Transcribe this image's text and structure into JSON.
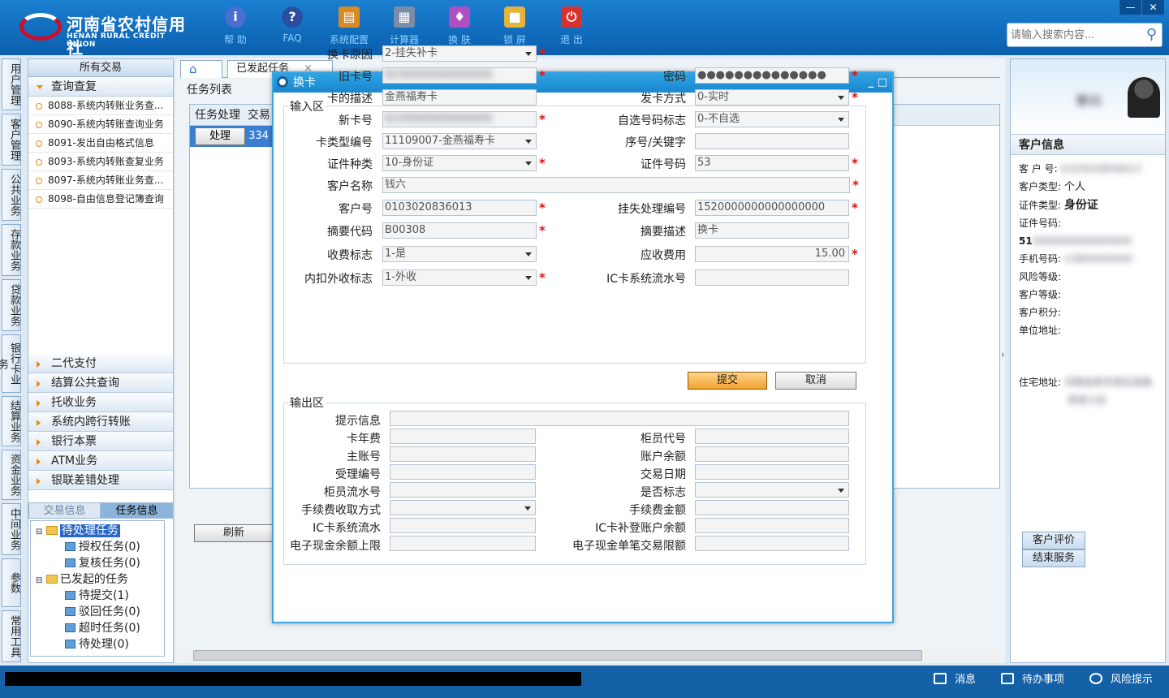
{
  "app": {
    "logo_cn": "河南省农村信用社",
    "logo_en": "HENAN RURAL CREDIT UNION",
    "toolbar": [
      "帮 助",
      "FAQ",
      "系统配置",
      "计算器",
      "换 肤",
      "锁 屏",
      "退 出"
    ],
    "search_placeholder": "请输入搜索内容...",
    "window_controls": [
      "—",
      "✕"
    ]
  },
  "vtabs": [
    "用户管理",
    "客户管理",
    "公共业务",
    "存款业务",
    "贷款业务",
    "银行卡业务",
    "结算业务",
    "资金业务",
    "中间业务",
    "参数",
    "常用工具"
  ],
  "leftpanel": {
    "header": "所有交易",
    "open_section": "查询查复",
    "items": [
      "8088-系统内转账业务查...",
      "8090-系统内转账查询业务",
      "8091-发出自由格式信息",
      "8093-系统内转账查复业务",
      "8097-系统内转账业务查...",
      "8098-自由信息登记簿查询"
    ],
    "sections": [
      "二代支付",
      "结算公共查询",
      "托收业务",
      "系统内跨行转账",
      "银行本票",
      "ATM业务",
      "银联差错处理"
    ],
    "info_tabs": [
      "交易信息",
      "任务信息"
    ],
    "tree": {
      "pending_root": "待处理任务",
      "pending_children": [
        "授权任务(0)",
        "复核任务(0)"
      ],
      "initiated_root": "已发起的任务",
      "initiated_children": [
        "待提交(1)",
        "驳回任务(0)",
        "超时任务(0)",
        "待处理(0)"
      ]
    }
  },
  "center": {
    "home_icon": "home-icon",
    "tab_label": "已发起任务",
    "tab_close": "×",
    "tasklist_label": "任务列表",
    "columns": [
      "任务处理",
      "交易"
    ],
    "row_button": "处理",
    "row_value": "334",
    "refresh": "刷新"
  },
  "dialog": {
    "title": "换卡",
    "input_area": "输入区",
    "output_area": "输出区",
    "fields_left": [
      {
        "label": "换卡原因",
        "value": "2-挂失补卡",
        "dropdown": true,
        "required": true
      },
      {
        "label": "旧卡号",
        "value": "",
        "blurred": true,
        "required": true
      },
      {
        "label": "卡的描述",
        "value": "金燕福寿卡"
      },
      {
        "label": "新卡号",
        "value": "",
        "blurred": true,
        "required": true
      },
      {
        "label": "卡类型编号",
        "value": "11109007-金燕福寿卡",
        "dropdown": true
      },
      {
        "label": "证件种类",
        "value": "10-身份证",
        "dropdown": true,
        "required": true
      },
      {
        "label": "客户名称",
        "value": "钱六",
        "wide": true,
        "required": true
      },
      {
        "label": "客户号",
        "value": "0103020836013",
        "required": true
      },
      {
        "label": "摘要代码",
        "value": "B00308",
        "required": true
      },
      {
        "label": "收费标志",
        "value": "1-是",
        "dropdown": true
      },
      {
        "label": "内扣外收标志",
        "value": "1-外收",
        "dropdown": true,
        "required": true
      }
    ],
    "fields_right": [
      {
        "label": "密码",
        "value": "●●●●●●●●●●●●●●",
        "required": true
      },
      {
        "label": "发卡方式",
        "value": "0-实时",
        "dropdown": true,
        "required": true
      },
      {
        "label": "自选号码标志",
        "value": "0-不自选",
        "dropdown": true
      },
      {
        "label": "序号/关键字",
        "value": ""
      },
      {
        "label": "证件号码",
        "value": "53",
        "required": true
      },
      {
        "label": "挂失处理编号",
        "value": "1520000000000000000",
        "required": true
      },
      {
        "label": "摘要描述",
        "value": "换卡"
      },
      {
        "label": "应收费用",
        "value": "15.00",
        "required": true
      },
      {
        "label": "IC卡系统流水号",
        "value": ""
      }
    ],
    "submit": "提交",
    "cancel": "取消",
    "output_left": [
      "提示信息",
      "卡年费",
      "主账号",
      "受理编号",
      "柜员流水号",
      "手续费收取方式",
      "IC卡系统流水",
      "电子现金余额上限"
    ],
    "output_right": [
      "柜员代号",
      "账户余额",
      "交易日期",
      "是否标志",
      "手续费金额",
      "IC卡补登账户余额",
      "电子现金单笔交易限额"
    ]
  },
  "rightpanel": {
    "name": "李兴",
    "title": "客户信息",
    "lines": [
      {
        "label": "客 户 号:",
        "value": ""
      },
      {
        "label": "客户类型:",
        "value": "个人"
      },
      {
        "label": "证件类型:",
        "value": "身份证"
      },
      {
        "label": "证件号码:",
        "value": ""
      },
      {
        "label": "51",
        "value": ""
      },
      {
        "label": "手机号码:",
        "value": ""
      },
      {
        "label": "风险等级:",
        "value": ""
      },
      {
        "label": "客户等级:",
        "value": ""
      },
      {
        "label": "客户积分:",
        "value": ""
      },
      {
        "label": "单位地址:",
        "value": ""
      }
    ],
    "home_address_label": "住宅地址:",
    "buttons": [
      "客户评价",
      "结束服务"
    ]
  },
  "bottombar": {
    "items": [
      "消息",
      "待办事项",
      "风险提示"
    ]
  }
}
